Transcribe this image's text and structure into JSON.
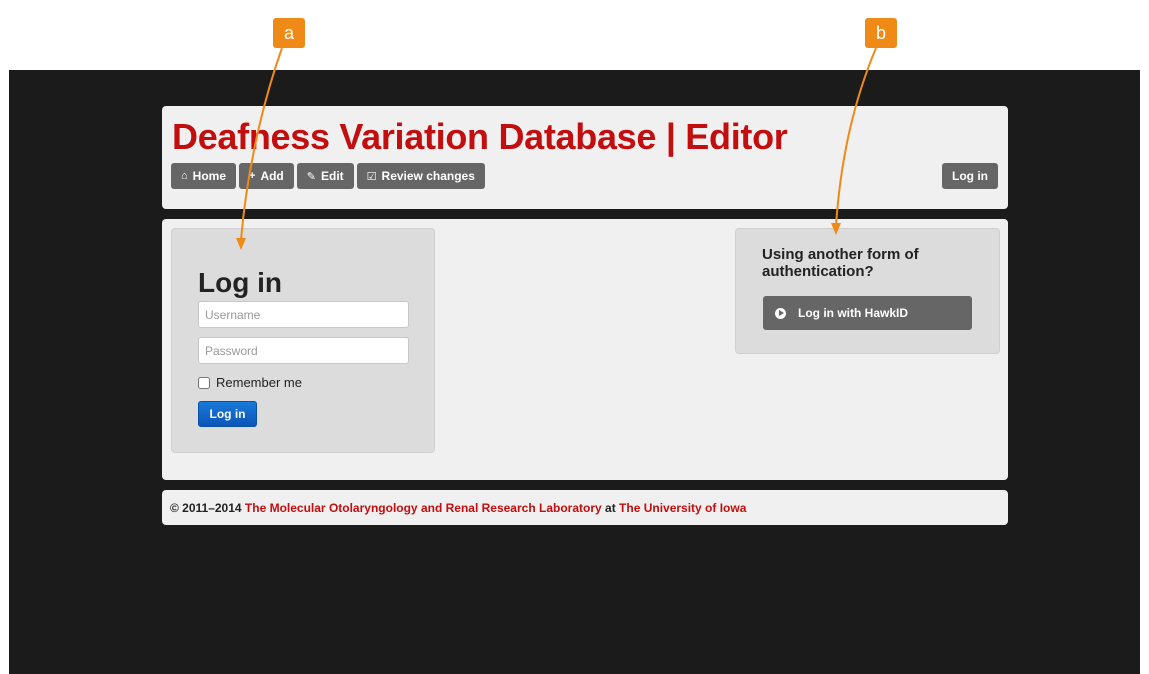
{
  "header": {
    "title": "Deafness Variation Database | Editor",
    "nav": [
      {
        "label": "Home",
        "icon": "home-icon"
      },
      {
        "label": "Add",
        "icon": "plus-icon"
      },
      {
        "label": "Edit",
        "icon": "pencil-icon"
      },
      {
        "label": "Review changes",
        "icon": "check-square-icon"
      }
    ],
    "login_label": "Log in"
  },
  "login_form": {
    "heading": "Log in",
    "username_placeholder": "Username",
    "password_placeholder": "Password",
    "remember_label": "Remember me",
    "submit_label": "Log in"
  },
  "alt_auth": {
    "heading": "Using another form of authentication?",
    "button_label": "Log in with HawkID",
    "button_icon": "arrow-circle-right-icon"
  },
  "footer": {
    "copyright": "© 2011–2014",
    "lab": "The Molecular Otolaryngology and Renal Research Laboratory",
    "at": "at",
    "university": "The University of Iowa"
  },
  "annotations": {
    "a": "a",
    "b": "b",
    "color": "#f08a17"
  },
  "colors": {
    "brand_red": "#c20e0e",
    "button_gray": "#666666",
    "primary_blue": "#0a55b8",
    "background_dark": "#1b1b1b"
  }
}
